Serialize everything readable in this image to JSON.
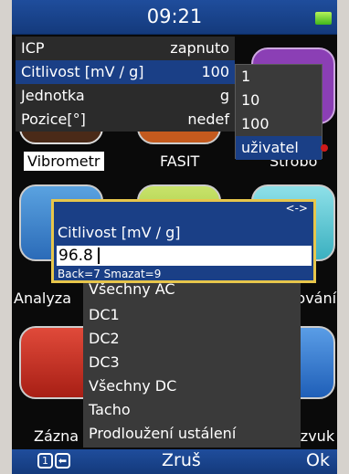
{
  "status": {
    "time": "09:21"
  },
  "settings": {
    "rows": [
      {
        "label": "ICP",
        "value": "zapnuto"
      },
      {
        "label": "Citlivost [mV / g]",
        "value": "100"
      },
      {
        "label": "Jednotka",
        "value": "g"
      },
      {
        "label": "Pozice[°]",
        "value": "nedef"
      }
    ]
  },
  "value_options": [
    "1",
    "10",
    "100",
    "uživatel"
  ],
  "tiles": {
    "vibrometr": "Vibrometr",
    "fasit": "FASIT",
    "strobo": "Strobo",
    "analyza": "Analyza",
    "zovani": "žování",
    "zaznam": "Zázna",
    "zvuk": "azvuk"
  },
  "dialog": {
    "nav": "<->",
    "title": "Citlivost [mV / g]",
    "value": "96.8",
    "hint": "Back=7 Smazat=9"
  },
  "channels": [
    "Všechny AC",
    "DC1",
    "DC2",
    "DC3",
    "Všechny DC",
    "Tacho",
    "Prodloužení ustálení"
  ],
  "bottom": {
    "key1": "1",
    "cancel": "Zruš",
    "ok": "Ok"
  }
}
